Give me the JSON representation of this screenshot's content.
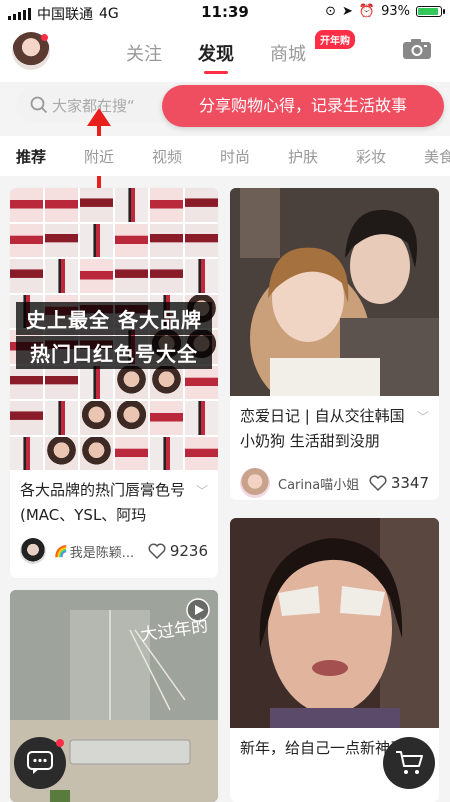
{
  "status_bar": {
    "carrier": "中国联通",
    "network": "4G",
    "time": "11:39",
    "battery": "93%",
    "battery_level": 0.93
  },
  "header": {
    "tabs": [
      {
        "label": "关注",
        "active": false
      },
      {
        "label": "发现",
        "active": true
      },
      {
        "label": "商城",
        "active": false
      }
    ],
    "mall_badge": "开年购",
    "camera_icon": "camera-icon",
    "avatar_icon": "user-avatar"
  },
  "search": {
    "placeholder": "大家都在搜“",
    "tooltip": "分享购物心得，记录生活故事"
  },
  "categories": [
    {
      "label": "推荐",
      "active": true
    },
    {
      "label": "附近",
      "active": false
    },
    {
      "label": "视频",
      "active": false
    },
    {
      "label": "时尚",
      "active": false
    },
    {
      "label": "护肤",
      "active": false
    },
    {
      "label": "彩妆",
      "active": false
    },
    {
      "label": "美食",
      "active": false
    }
  ],
  "feed": {
    "cards": [
      {
        "image_text_1": "史上最全 各大品牌",
        "image_text_2": "热门口红色号大全",
        "title": "各大品牌的热门唇膏色号(MAC、YSL、阿玛",
        "author": "我是陈颖...",
        "likes": "9236"
      },
      {
        "title": "恋爱日记 | 自从交往韩国小奶狗 生活甜到没朋",
        "author": "Carina喵小姐",
        "likes": "3347"
      },
      {
        "image_text": "大过年的",
        "title": ""
      },
      {
        "title": "新年，给自己一点新神采"
      }
    ]
  },
  "colors": {
    "brand_red": "#ff2d45",
    "tooltip_bg": "#ef4e61"
  }
}
